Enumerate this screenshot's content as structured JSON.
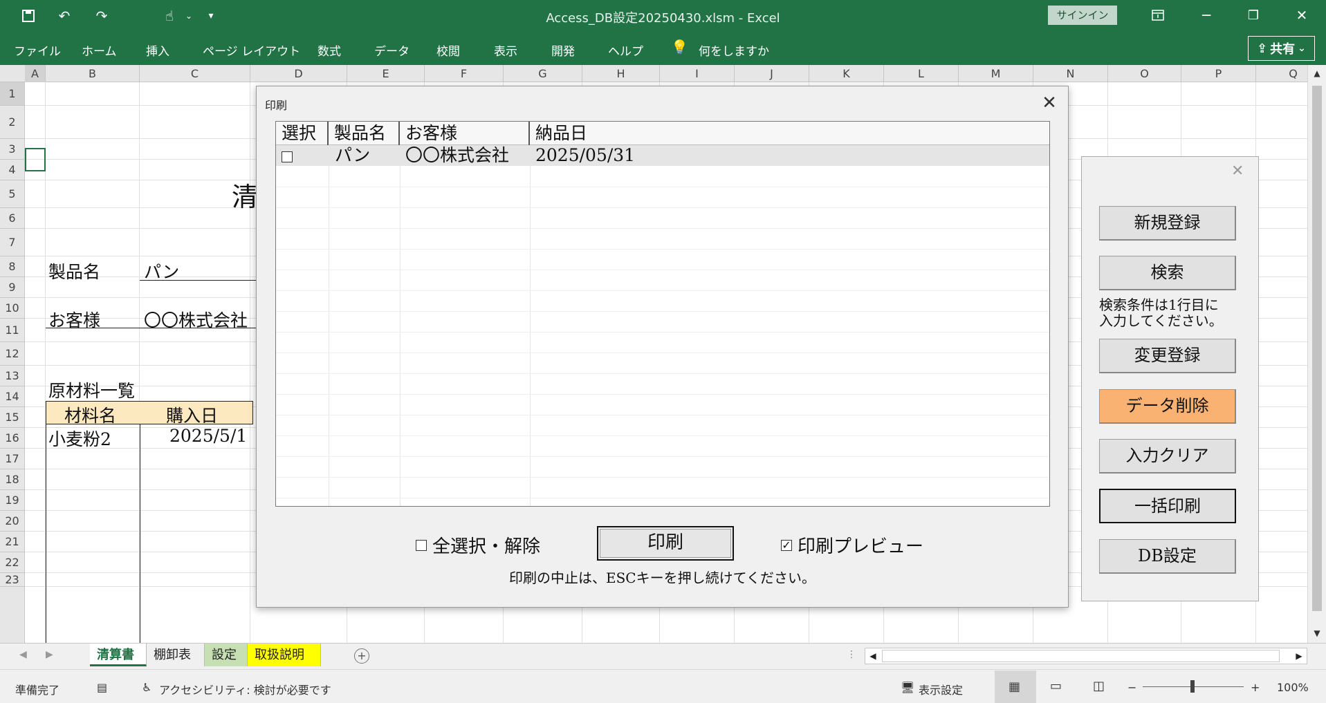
{
  "window": {
    "title": "Access_DB設定20250430.xlsm  -  Excel",
    "signin": "サインイン"
  },
  "ribbon": {
    "tabs": [
      "ファイル",
      "ホーム",
      "挿入",
      "ページ レイアウト",
      "数式",
      "データ",
      "校閲",
      "表示",
      "開発",
      "ヘルプ",
      "何をしますか"
    ],
    "share": "共有"
  },
  "grid": {
    "columns": [
      "A",
      "B",
      "C",
      "D",
      "E",
      "F",
      "G",
      "H",
      "I",
      "J",
      "K",
      "L",
      "M",
      "N",
      "O",
      "P",
      "Q"
    ],
    "rows": [
      "1",
      "2",
      "3",
      "4",
      "5",
      "6",
      "7",
      "8",
      "9",
      "10",
      "11",
      "12",
      "13",
      "14",
      "15",
      "16",
      "17",
      "18",
      "19",
      "20",
      "21",
      "22",
      "23"
    ],
    "cells": {
      "c2_title": "清",
      "b5_label": "製品名",
      "c5_value": "パン",
      "b7_label": "お客様",
      "c7_value": "〇〇株式会社",
      "b10_label": "原材料一覧",
      "b11_header": "材料名",
      "c11_header": "購入日",
      "b12_value": "小麦粉2",
      "c12_value": "2025/5/1"
    }
  },
  "dialog": {
    "title": "印刷",
    "columns": [
      "選択",
      "製品名",
      "お客様",
      "納品日"
    ],
    "rows": [
      {
        "selected": false,
        "product": "パン",
        "customer": "〇〇株式会社",
        "delivery": "2025/05/31"
      }
    ],
    "select_all_label": "全選択・解除",
    "select_all_checked": false,
    "print_button": "印刷",
    "preview_label": "印刷プレビュー",
    "preview_checked": true,
    "esc_note": "印刷の中止は、ESCキーを押し続けてください。"
  },
  "side_panel": {
    "buttons": [
      "新規登録",
      "検索",
      "変更登録",
      "データ削除",
      "入力クリア",
      "一括印刷",
      "DB設定"
    ],
    "search_note_1": "検索条件は1行目に",
    "search_note_2": "入力してください。",
    "delete_color": "#f9b271"
  },
  "sheets": {
    "tabs": [
      {
        "label": "清算書",
        "color": "#ffffff",
        "active": true
      },
      {
        "label": "棚卸表",
        "color": "#f0f0f0",
        "active": false
      },
      {
        "label": "設定",
        "color": "#c6e0b4",
        "active": false
      },
      {
        "label": "取扱説明",
        "color": "#ffff00",
        "active": false
      }
    ]
  },
  "status": {
    "ready": "準備完了",
    "accessibility": "アクセシビリティ: 検討が必要です",
    "display_settings": "表示設定",
    "zoom": "100%"
  }
}
